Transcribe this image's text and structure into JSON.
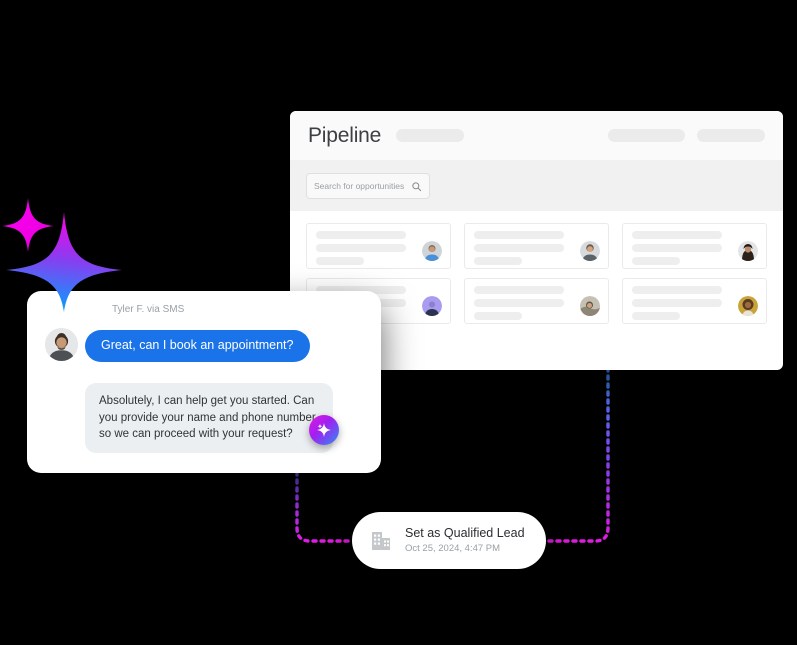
{
  "pipeline": {
    "title": "Pipeline",
    "header_pills": [
      "pill-title",
      "pill-right-1",
      "pill-right-2"
    ],
    "search": {
      "placeholder": "Search for opportunities",
      "value": "",
      "icon": "search-icon"
    },
    "cards": [
      {
        "avatar": "avatar-man-blue-shirt"
      },
      {
        "avatar": "avatar-man-beard"
      },
      {
        "avatar": "avatar-woman-dark-hair"
      },
      {
        "avatar": "avatar-person-purple"
      },
      {
        "avatar": "avatar-person-outdoors"
      },
      {
        "avatar": "avatar-woman-curly-hair"
      }
    ]
  },
  "chat": {
    "sender": "Tyler F. via SMS",
    "avatar": "avatar-tyler",
    "messages": [
      {
        "direction": "incoming",
        "text": "Great, can I book an appointment?",
        "color": "#1a73e8"
      },
      {
        "direction": "outgoing",
        "text": "Absolutely, I can help get you started. Can you provide your name and phone number so we can proceed with your request?",
        "color": "#eceff1"
      }
    ],
    "ai_badge": {
      "icon": "sparkle-icon",
      "gradient_from": "#e11ae1",
      "gradient_to": "#2f8bf5"
    }
  },
  "decoration": {
    "sparkle": {
      "icon": "sparkle-icon",
      "gradient_from": "#ff00e6",
      "gradient_to": "#00a3ff"
    }
  },
  "action_card": {
    "icon": "building-icon",
    "title": "Set as Qualified Lead",
    "timestamp": "Oct 25, 2024, 4:47 PM"
  },
  "connectors": {
    "left_line_color_top": "#2f8bf5",
    "left_line_color_bottom": "#e11ae1",
    "right_line_color_top": "#2f8bf5",
    "right_line_color_bottom": "#e11ae1",
    "style": "dotted"
  },
  "theme": {
    "background": "#000000",
    "panel_background": "#ffffff",
    "accent_blue": "#1a73e8",
    "accent_magenta": "#e11ae1"
  }
}
